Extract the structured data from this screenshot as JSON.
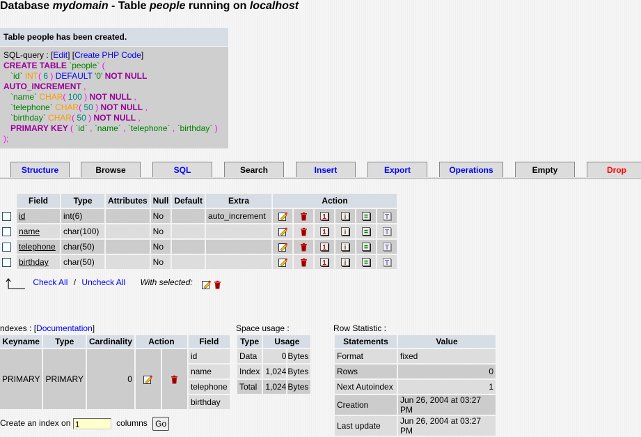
{
  "title": {
    "p1": "Database ",
    "db": "mydomain",
    "p2": " - Table ",
    "table": "people",
    "p3": " running on ",
    "host": "localhost"
  },
  "message": {
    "header": "Table people has been created.",
    "sql_label": "SQL-query : ",
    "edit_link": "Edit",
    "php_link": "Create PHP Code",
    "sql_lines": [
      "CREATE TABLE `people` (",
      "`id` INT( 6 ) DEFAULT '0' NOT NULL AUTO_INCREMENT ,",
      "`name` CHAR( 100 ) NOT NULL ,",
      "`telephone` CHAR( 50 ) NOT NULL ,",
      "`birthday` CHAR( 50 ) NOT NULL ,",
      "PRIMARY KEY ( `id` , `name` , `telephone` , `birthday` )",
      ");"
    ]
  },
  "tabs": [
    {
      "label": "Structure",
      "color": "#0000ff"
    },
    {
      "label": "Browse",
      "color": "#000000"
    },
    {
      "label": "SQL",
      "color": "#0000ff"
    },
    {
      "label": "Search",
      "color": "#000000"
    },
    {
      "label": "Insert",
      "color": "#0000ff"
    },
    {
      "label": "Export",
      "color": "#0000ff"
    },
    {
      "label": "Operations",
      "color": "#0000ff"
    },
    {
      "label": "Empty",
      "color": "#000000"
    },
    {
      "label": "Drop",
      "color": "#ff0000"
    }
  ],
  "fields_table": {
    "headers": [
      "Field",
      "Type",
      "Attributes",
      "Null",
      "Default",
      "Extra",
      "Action"
    ],
    "rows": [
      {
        "field": "id",
        "type": "int(6)",
        "attributes": "",
        "null": "No",
        "default": "",
        "extra": "auto_increment"
      },
      {
        "field": "name",
        "type": "char(100)",
        "attributes": "",
        "null": "No",
        "default": "",
        "extra": ""
      },
      {
        "field": "telephone",
        "type": "char(50)",
        "attributes": "",
        "null": "No",
        "default": "",
        "extra": ""
      },
      {
        "field": "birthday",
        "type": "char(50)",
        "attributes": "",
        "null": "No",
        "default": "",
        "extra": ""
      }
    ],
    "action_icons": [
      "edit-icon",
      "drop-icon",
      "primary-icon",
      "index-icon",
      "unique-icon",
      "fulltext-icon"
    ]
  },
  "selection": {
    "check_all": "Check All",
    "separator": "/",
    "uncheck_all": "Uncheck All",
    "with_selected": "With selected:"
  },
  "indexes": {
    "label": "ndexes : ",
    "doc_link": "Documentation",
    "headers": [
      "Keyname",
      "Type",
      "Cardinality",
      "Action",
      "Field"
    ],
    "row": {
      "keyname": "PRIMARY",
      "type": "PRIMARY",
      "cardinality": "0",
      "fields": [
        "id",
        "name",
        "telephone",
        "birthday"
      ]
    },
    "create_label": "Create an index on",
    "create_value": "1",
    "columns_label": "columns",
    "go_label": "Go"
  },
  "space_usage": {
    "label": "Space usage :",
    "headers": [
      "Type",
      "Usage"
    ],
    "rows": [
      {
        "type": "Data",
        "value": "0",
        "unit": "Bytes"
      },
      {
        "type": "Index",
        "value": "1,024",
        "unit": "Bytes"
      },
      {
        "type": "Total",
        "value": "1,024",
        "unit": "Bytes"
      }
    ]
  },
  "row_statistic": {
    "label": "Row Statistic :",
    "headers": [
      "Statements",
      "Value"
    ],
    "rows": [
      {
        "statement": "Format",
        "value": "fixed"
      },
      {
        "statement": "Rows",
        "value": "0"
      },
      {
        "statement": "Next Autoindex",
        "value": "1"
      },
      {
        "statement": "Creation",
        "value": "Jun 26, 2004 at 03:27 PM"
      },
      {
        "statement": "Last update",
        "value": "Jun 26, 2004 at 03:27 PM"
      }
    ]
  }
}
